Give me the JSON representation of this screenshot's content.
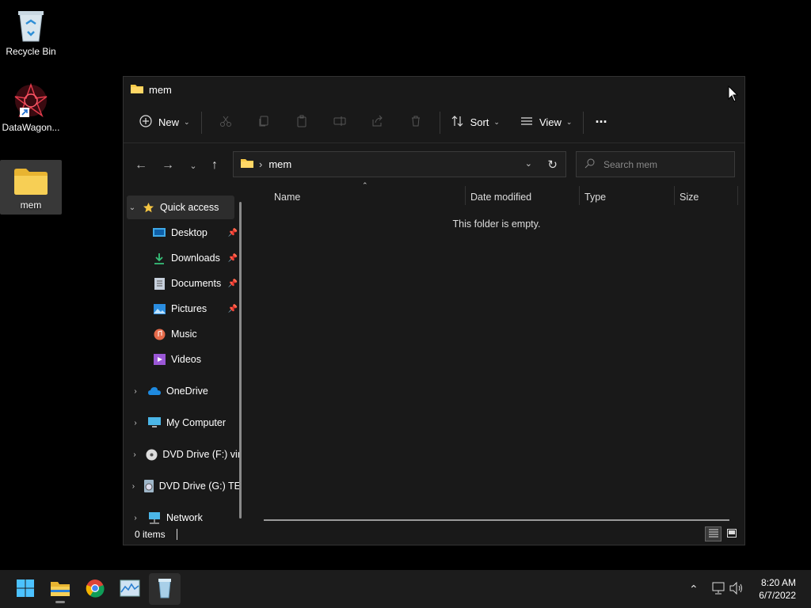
{
  "desktop": {
    "icons": [
      {
        "label": "Recycle Bin",
        "icon": "recycle-bin-icon"
      },
      {
        "label": "DataWagon...",
        "icon": "datawagon-shortcut-icon"
      },
      {
        "label": "mem",
        "icon": "folder-icon"
      }
    ]
  },
  "window": {
    "title": "mem",
    "toolbar": {
      "new_label": "New",
      "sort_label": "Sort",
      "view_label": "View",
      "more_label": "···"
    },
    "address": {
      "crumb": "mem",
      "separator": "›"
    },
    "search": {
      "placeholder": "Search mem"
    },
    "sidebar": {
      "items": [
        {
          "label": "Quick access",
          "icon": "star-icon"
        },
        {
          "label": "Desktop",
          "icon": "desktop-icon",
          "pinned": true
        },
        {
          "label": "Downloads",
          "icon": "download-icon",
          "pinned": true
        },
        {
          "label": "Documents",
          "icon": "documents-icon",
          "pinned": true
        },
        {
          "label": "Pictures",
          "icon": "pictures-icon",
          "pinned": true
        },
        {
          "label": "Music",
          "icon": "music-icon"
        },
        {
          "label": "Videos",
          "icon": "videos-icon"
        },
        {
          "label": "OneDrive",
          "icon": "onedrive-icon"
        },
        {
          "label": "My Computer",
          "icon": "computer-icon"
        },
        {
          "label": "DVD Drive (F:) vir",
          "icon": "dvd-icon"
        },
        {
          "label": "DVD Drive (G:) TE",
          "icon": "dvd-drive-icon"
        },
        {
          "label": "Network",
          "icon": "network-icon"
        }
      ]
    },
    "columns": [
      "Name",
      "Date modified",
      "Type",
      "Size"
    ],
    "empty_message": "This folder is empty.",
    "status": {
      "item_count": "0 items"
    }
  },
  "taskbar": {
    "apps": [
      "start-icon",
      "file-explorer-icon",
      "chrome-icon",
      "task-manager-icon",
      "app-icon"
    ],
    "time": "8:20 AM",
    "date": "6/7/2022"
  },
  "colors": {
    "accent": "#0078d4",
    "folder": "#f5c542",
    "background": "#000000",
    "window": "#191919"
  }
}
